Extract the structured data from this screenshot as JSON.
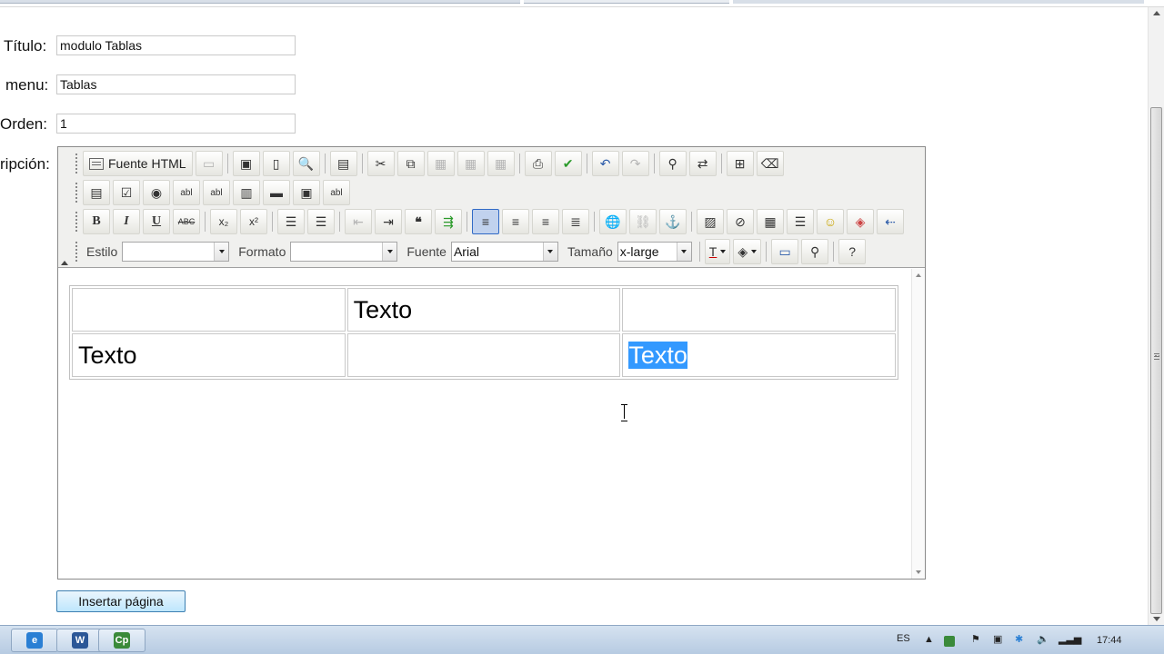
{
  "form": {
    "titulo_label": "Título:",
    "titulo_value": "modulo Tablas",
    "menu_label": "menu:",
    "menu_value": "Tablas",
    "orden_label": "Orden:",
    "orden_value": "1",
    "descripcion_label": "ripción:",
    "submit_label": "Insertar página"
  },
  "toolbar": {
    "source_button": "Fuente HTML",
    "bold": "B",
    "italic": "I",
    "underline": "U",
    "strike": "ABC",
    "subscript": "x₂",
    "superscript": "x²",
    "estilo_label": "Estilo",
    "estilo_value": "",
    "formato_label": "Formato",
    "formato_value": "",
    "fuente_label": "Fuente",
    "fuente_value": "Arial",
    "tamano_label": "Tamaño",
    "tamano_value": "x-large"
  },
  "table": {
    "rows": [
      [
        "",
        "Texto",
        ""
      ],
      [
        "Texto",
        "",
        "Texto"
      ]
    ]
  },
  "taskbar": {
    "language": "ES",
    "clock": "17:44",
    "apps": [
      "internet-explorer-icon",
      "word-icon",
      "captivate-icon"
    ]
  }
}
